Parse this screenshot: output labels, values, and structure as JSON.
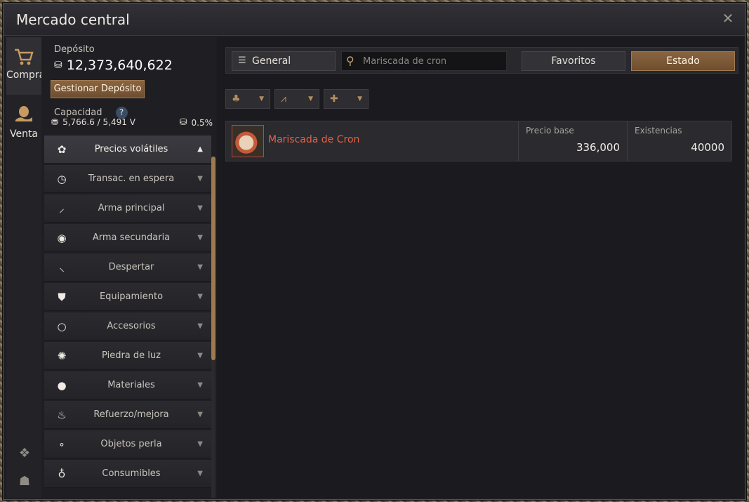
{
  "window": {
    "title": "Mercado central"
  },
  "tabs": [
    {
      "label": "Compra",
      "icon": "cart-icon"
    },
    {
      "label": "Venta",
      "icon": "hand-bag-icon"
    }
  ],
  "bottom_icons": [
    "tree-icon",
    "backpack-icon"
  ],
  "deposit": {
    "label": "Depósito",
    "value": "12,373,640,622",
    "manage_label": "Gestionar Depósito"
  },
  "capacity": {
    "label": "Capacidad",
    "help": "?",
    "weight": "5,766.6 / 5,491 V",
    "tax": "0.5%"
  },
  "categories": [
    {
      "label": "Precios volátiles",
      "icon": "gear-icon",
      "active": true
    },
    {
      "label": "Transac. en espera",
      "icon": "clock-icon"
    },
    {
      "label": "Arma principal",
      "icon": "sword-icon"
    },
    {
      "label": "Arma secundaria",
      "icon": "shield-icon"
    },
    {
      "label": "Despertar",
      "icon": "blade-icon"
    },
    {
      "label": "Equipamiento",
      "icon": "armor-icon"
    },
    {
      "label": "Accesorios",
      "icon": "ring-icon"
    },
    {
      "label": "Piedra de luz",
      "icon": "lightstone-icon"
    },
    {
      "label": "Materiales",
      "icon": "material-icon"
    },
    {
      "label": "Refuerzo/mejora",
      "icon": "flame-icon"
    },
    {
      "label": "Objetos perla",
      "icon": "pearl-icon"
    },
    {
      "label": "Consumibles",
      "icon": "potion-icon"
    }
  ],
  "toolbar": {
    "category_label": "General",
    "search_placeholder": "Mariscada de cron",
    "favorites_label": "Favoritos",
    "status_label": "Estado"
  },
  "filters": [
    {
      "icon": "bag-icon"
    },
    {
      "icon": "graph-icon"
    },
    {
      "icon": "plus-icon"
    }
  ],
  "item": {
    "name": "Mariscada de Cron",
    "base_price_label": "Precio base",
    "base_price": "336,000",
    "stock_label": "Existencias",
    "stock": "40000"
  },
  "colors": {
    "accent": "#8a6440",
    "item_name": "#e0644a"
  }
}
